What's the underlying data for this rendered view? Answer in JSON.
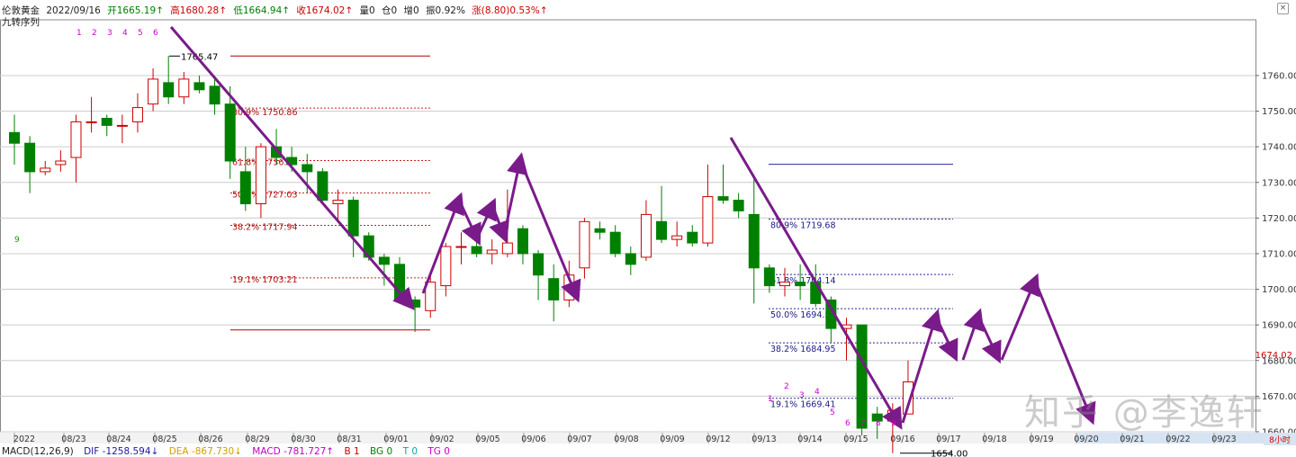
{
  "header": {
    "symbol": "伦敦黄金",
    "date": "2022/09/16",
    "open": "开1665.19↑",
    "high": "高1680.28↑",
    "low": "低1664.94↑",
    "close": "收1674.02↑",
    "volume": "量0",
    "oi": "仓0",
    "change_oi": "增0",
    "amplitude": "振0.92%",
    "change": "涨(8.80)0.53%↑",
    "indicator": "九转序列",
    "close_icon": "close-icon"
  },
  "counters": {
    "top": [
      "1",
      "2",
      "3",
      "4",
      "5",
      "6"
    ],
    "left_green": "9",
    "bottom_a": [
      "1",
      "2",
      "3",
      "4"
    ],
    "bottom_b": [
      "5",
      "6",
      "7",
      "8",
      "9"
    ]
  },
  "annotations": {
    "high_label": "1765.47",
    "low_label": "1654.00"
  },
  "watermark": "知乎 @李逸轩",
  "last_price": "1674.02",
  "timeframe": "8小时",
  "footer": {
    "macd_name": "MACD(12,26,9)",
    "dif": "DIF -1258.594↓",
    "dea": "DEA -867.730↓",
    "macd": "MACD -781.727↑",
    "b": "B 1",
    "bg": "BG 0",
    "t": "T 0",
    "tg": "TG 0"
  },
  "chart_data": {
    "type": "candlestick",
    "ylim": [
      1651,
      1770
    ],
    "y_ticks": [
      1660,
      1670,
      1680,
      1690,
      1700,
      1710,
      1720,
      1730,
      1740,
      1750,
      1760
    ],
    "x_ticks": [
      "2022",
      "08/23",
      "08/24",
      "08/25",
      "08/26",
      "08/29",
      "08/30",
      "08/31",
      "09/01",
      "09/02",
      "09/05",
      "09/06",
      "09/07",
      "09/08",
      "09/09",
      "09/12",
      "09/13",
      "09/14",
      "09/15",
      "09/16",
      "09/17",
      "09/18",
      "09/19",
      "09/20",
      "09/21",
      "09/22",
      "09/23"
    ],
    "candles": [
      {
        "o": 1744,
        "c": 1741,
        "h": 1749,
        "l": 1735
      },
      {
        "o": 1741,
        "c": 1733,
        "h": 1743,
        "l": 1727
      },
      {
        "o": 1733,
        "c": 1734,
        "h": 1736,
        "l": 1732
      },
      {
        "o": 1735,
        "c": 1736,
        "h": 1739,
        "l": 1733
      },
      {
        "o": 1737,
        "c": 1747,
        "h": 1749,
        "l": 1730
      },
      {
        "o": 1747,
        "c": 1747,
        "h": 1754,
        "l": 1744
      },
      {
        "o": 1748,
        "c": 1746,
        "h": 1749,
        "l": 1743
      },
      {
        "o": 1746,
        "c": 1746,
        "h": 1749,
        "l": 1741
      },
      {
        "o": 1747,
        "c": 1751,
        "h": 1755,
        "l": 1744
      },
      {
        "o": 1752,
        "c": 1759,
        "h": 1762,
        "l": 1750
      },
      {
        "o": 1758,
        "c": 1754,
        "h": 1765.5,
        "l": 1752
      },
      {
        "o": 1754,
        "c": 1759,
        "h": 1761,
        "l": 1752
      },
      {
        "o": 1758,
        "c": 1756,
        "h": 1760,
        "l": 1755
      },
      {
        "o": 1757,
        "c": 1752,
        "h": 1759,
        "l": 1749
      },
      {
        "o": 1752,
        "c": 1736,
        "h": 1757,
        "l": 1731
      },
      {
        "o": 1733,
        "c": 1724,
        "h": 1740,
        "l": 1722
      },
      {
        "o": 1724,
        "c": 1740,
        "h": 1741,
        "l": 1720
      },
      {
        "o": 1740,
        "c": 1737,
        "h": 1745,
        "l": 1735
      },
      {
        "o": 1737,
        "c": 1735,
        "h": 1740,
        "l": 1733
      },
      {
        "o": 1735,
        "c": 1733,
        "h": 1738,
        "l": 1727
      },
      {
        "o": 1733,
        "c": 1725,
        "h": 1734,
        "l": 1724
      },
      {
        "o": 1724,
        "c": 1725,
        "h": 1728,
        "l": 1719
      },
      {
        "o": 1725,
        "c": 1715,
        "h": 1726,
        "l": 1709
      },
      {
        "o": 1715,
        "c": 1709,
        "h": 1716,
        "l": 1708
      },
      {
        "o": 1709,
        "c": 1707,
        "h": 1710,
        "l": 1701
      },
      {
        "o": 1707,
        "c": 1697,
        "h": 1709,
        "l": 1696
      },
      {
        "o": 1697,
        "c": 1695,
        "h": 1698,
        "l": 1688
      },
      {
        "o": 1694,
        "c": 1702,
        "h": 1704,
        "l": 1692
      },
      {
        "o": 1701,
        "c": 1712,
        "h": 1713,
        "l": 1698
      },
      {
        "o": 1712,
        "c": 1712,
        "h": 1716,
        "l": 1707
      },
      {
        "o": 1712,
        "c": 1710,
        "h": 1716,
        "l": 1709
      },
      {
        "o": 1710,
        "c": 1711,
        "h": 1714,
        "l": 1707
      },
      {
        "o": 1710,
        "c": 1713,
        "h": 1728,
        "l": 1709
      },
      {
        "o": 1717,
        "c": 1710,
        "h": 1718,
        "l": 1707
      },
      {
        "o": 1710,
        "c": 1704,
        "h": 1711,
        "l": 1697
      },
      {
        "o": 1703,
        "c": 1697,
        "h": 1707,
        "l": 1691
      },
      {
        "o": 1697,
        "c": 1704,
        "h": 1708,
        "l": 1695
      },
      {
        "o": 1706,
        "c": 1719,
        "h": 1720,
        "l": 1703
      },
      {
        "o": 1717,
        "c": 1716,
        "h": 1719,
        "l": 1714
      },
      {
        "o": 1716,
        "c": 1710,
        "h": 1718,
        "l": 1709
      },
      {
        "o": 1710,
        "c": 1707,
        "h": 1712,
        "l": 1704
      },
      {
        "o": 1709,
        "c": 1721,
        "h": 1725,
        "l": 1708
      },
      {
        "o": 1719,
        "c": 1714,
        "h": 1729,
        "l": 1713
      },
      {
        "o": 1714,
        "c": 1715,
        "h": 1719,
        "l": 1712
      },
      {
        "o": 1716,
        "c": 1713,
        "h": 1718,
        "l": 1712
      },
      {
        "o": 1713,
        "c": 1726,
        "h": 1735,
        "l": 1712
      },
      {
        "o": 1726,
        "c": 1725,
        "h": 1735,
        "l": 1724
      },
      {
        "o": 1725,
        "c": 1722,
        "h": 1727,
        "l": 1720
      },
      {
        "o": 1721,
        "c": 1706,
        "h": 1732,
        "l": 1696
      },
      {
        "o": 1706,
        "c": 1701,
        "h": 1707,
        "l": 1699
      },
      {
        "o": 1701,
        "c": 1702,
        "h": 1706,
        "l": 1698
      },
      {
        "o": 1702,
        "c": 1701,
        "h": 1707,
        "l": 1697
      },
      {
        "o": 1702,
        "c": 1696,
        "h": 1707,
        "l": 1695
      },
      {
        "o": 1697,
        "c": 1689,
        "h": 1698,
        "l": 1685
      },
      {
        "o": 1689,
        "c": 1690,
        "h": 1692,
        "l": 1680
      },
      {
        "o": 1690,
        "c": 1661,
        "h": 1690,
        "l": 1659
      },
      {
        "o": 1665,
        "c": 1663,
        "h": 1667,
        "l": 1658
      },
      {
        "o": 1663,
        "c": 1666,
        "h": 1668,
        "l": 1654
      },
      {
        "o": 1665,
        "c": 1674,
        "h": 1680,
        "l": 1665
      }
    ],
    "fib_levels_1": [
      {
        "label": "80.9% 1750.86",
        "value": 1750.86
      },
      {
        "label": "61.8% 1736.13",
        "value": 1736.13
      },
      {
        "label": "50.0% 1727.03",
        "value": 1727.03
      },
      {
        "label": "38.2% 1717.94",
        "value": 1717.94
      },
      {
        "label": "19.1% 1703.21",
        "value": 1703.21
      }
    ],
    "fib_levels_2": [
      {
        "label": "80.9% 1719.68",
        "value": 1719.68
      },
      {
        "label": "61.8% 1704.14",
        "value": 1704.14
      },
      {
        "label": "50.0% 1694.54",
        "value": 1694.54
      },
      {
        "label": "38.2% 1684.95",
        "value": 1684.95
      },
      {
        "label": "19.1% 1669.41",
        "value": 1669.41
      }
    ],
    "fib1_top": 1765.47,
    "fib1_bottom": 1688.6,
    "fib2_top": 1735.1,
    "fib2_bottom": 1651.2,
    "colors": {
      "up": "#cc0000",
      "down": "#008000",
      "fib1": "#b00000",
      "fib2": "#000090",
      "arrow": "#7a1b8a",
      "grid": "#cccccc"
    }
  }
}
